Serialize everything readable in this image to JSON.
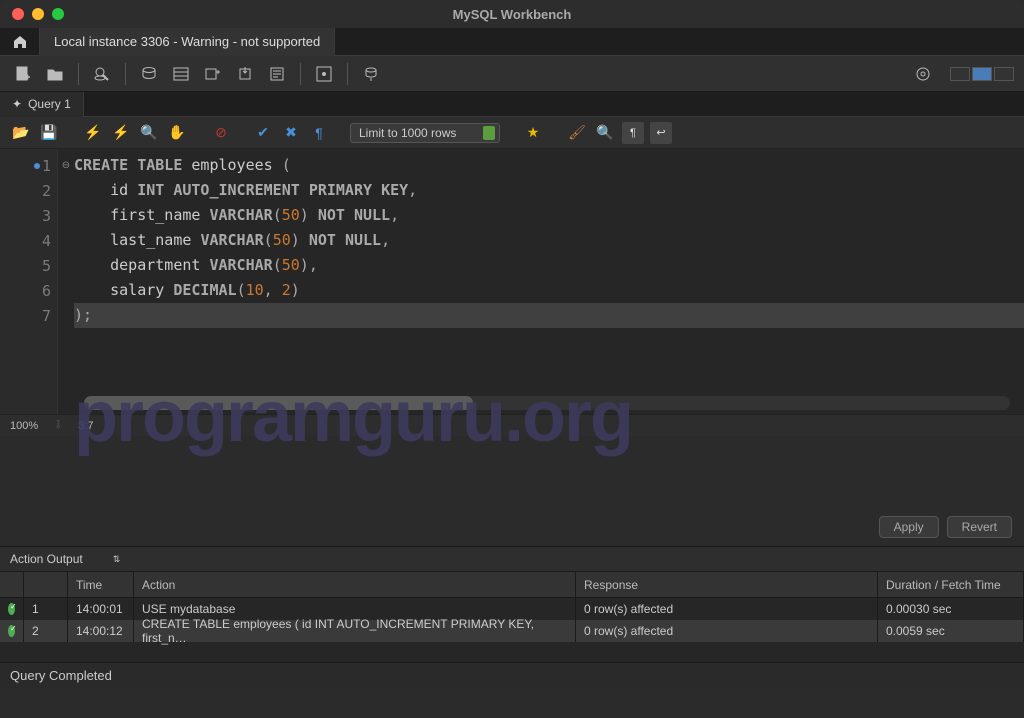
{
  "window": {
    "title": "MySQL Workbench"
  },
  "connection_tab": "Local instance 3306 - Warning - not supported",
  "file_tab": {
    "name": "Query 1"
  },
  "limit_dropdown": "Limit to 1000 rows",
  "code": {
    "lines": [
      {
        "n": "1",
        "html": "<span class='kw'>CREATE</span> <span class='kw'>TABLE</span> <span class='ident'>employees</span> <span class='punc'>(</span>"
      },
      {
        "n": "2",
        "html": "    <span class='ident'>id</span> <span class='type'>INT</span> <span class='kw'>AUTO_INCREMENT</span> <span class='kw'>PRIMARY</span> <span class='kw'>KEY</span><span class='punc'>,</span>"
      },
      {
        "n": "3",
        "html": "    <span class='ident'>first_name</span> <span class='type'>VARCHAR</span><span class='punc'>(</span><span class='num'>50</span><span class='punc'>)</span> <span class='kw'>NOT</span> <span class='kw'>NULL</span><span class='punc'>,</span>"
      },
      {
        "n": "4",
        "html": "    <span class='ident'>last_name</span> <span class='type'>VARCHAR</span><span class='punc'>(</span><span class='num'>50</span><span class='punc'>)</span> <span class='kw'>NOT</span> <span class='kw'>NULL</span><span class='punc'>,</span>"
      },
      {
        "n": "5",
        "html": "    <span class='ident'>department</span> <span class='type'>VARCHAR</span><span class='punc'>(</span><span class='num'>50</span><span class='punc'>)</span><span class='punc'>,</span>"
      },
      {
        "n": "6",
        "html": "    <span class='ident'>salary</span> <span class='type'>DECIMAL</span><span class='punc'>(</span><span class='num'>10</span><span class='punc'>,</span> <span class='num'>2</span><span class='punc'>)</span>"
      },
      {
        "n": "7",
        "html": "<span class='punc'>);</span>"
      }
    ]
  },
  "status": {
    "zoom": "100%",
    "cursor": "3:7"
  },
  "buttons": {
    "apply": "Apply",
    "revert": "Revert"
  },
  "output": {
    "label": "Action Output",
    "headers": {
      "time": "Time",
      "action": "Action",
      "response": "Response",
      "duration": "Duration / Fetch Time"
    },
    "rows": [
      {
        "idx": "1",
        "time": "14:00:01",
        "action": "USE mydatabase",
        "response": "0 row(s) affected",
        "duration": "0.00030 sec"
      },
      {
        "idx": "2",
        "time": "14:00:12",
        "action": "CREATE TABLE employees (     id INT AUTO_INCREMENT PRIMARY KEY,     first_n…",
        "response": "0 row(s) affected",
        "duration": "0.0059 sec"
      }
    ]
  },
  "footer_status": "Query Completed",
  "watermark": "programguru.org"
}
